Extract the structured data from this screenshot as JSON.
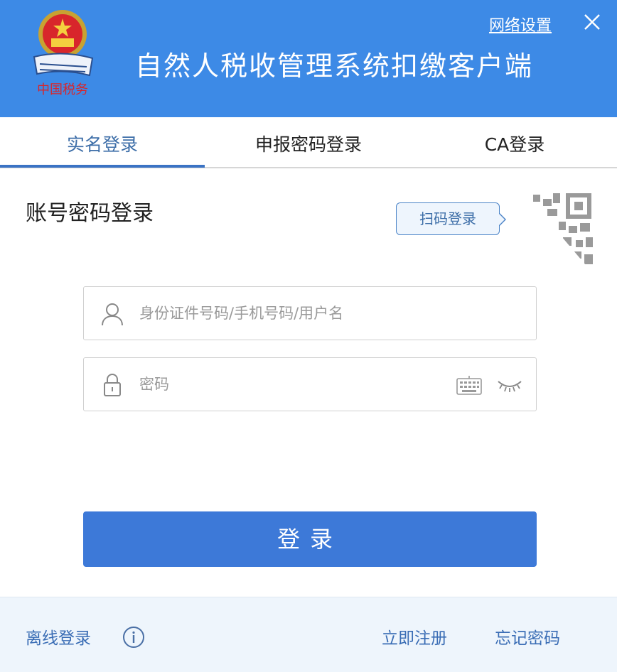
{
  "header": {
    "title": "自然人税收管理系统扣缴客户端",
    "network_settings": "网络设置",
    "close_icon": "close-icon",
    "emblem_icon": "tax-emblem-icon",
    "bg_color": "#3d8ae6"
  },
  "tabs": [
    {
      "label": "实名登录",
      "active": true
    },
    {
      "label": "申报密码登录",
      "active": false
    },
    {
      "label": "CA登录",
      "active": false
    }
  ],
  "form": {
    "section_title": "账号密码登录",
    "qr_tooltip": "扫码登录",
    "username": {
      "value": "",
      "placeholder": "身份证件号码/手机号码/用户名",
      "icon": "user-icon"
    },
    "password": {
      "value": "",
      "placeholder": "密码",
      "icon": "lock-icon"
    },
    "keyboard_icon": "keyboard-icon",
    "eye_icon": "eye-closed-icon",
    "login_label": "登录",
    "accent_color": "#3d79d8"
  },
  "footer": {
    "offline_login": "离线登录",
    "register": "立即注册",
    "forgot_password": "忘记密码",
    "info_icon": "info-icon"
  }
}
